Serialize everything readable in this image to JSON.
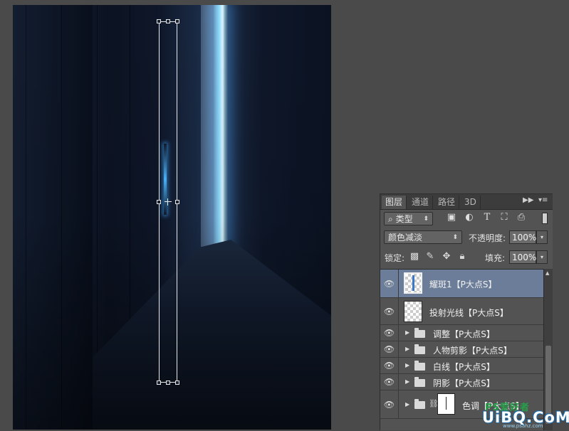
{
  "layers_panel": {
    "tabs": [
      {
        "label": "图层",
        "active": true
      },
      {
        "label": "通道",
        "active": false
      },
      {
        "label": "路径",
        "active": false
      },
      {
        "label": "3D",
        "active": false
      }
    ],
    "filter": {
      "kind_label": "类型"
    },
    "blend": {
      "mode": "颜色减淡",
      "opacity_label": "不透明度:",
      "opacity_value": "100%"
    },
    "lock": {
      "label": "锁定:",
      "fill_label": "填充:",
      "fill_value": "100%"
    },
    "layers": [
      {
        "name": "耀斑1【P大点S】",
        "type": "pixel",
        "selected": true,
        "visible": true
      },
      {
        "name": "投射光线【P大点S】",
        "type": "pixel",
        "selected": false,
        "visible": true
      },
      {
        "name": "调整【P大点S】",
        "type": "group",
        "selected": false,
        "visible": true
      },
      {
        "name": "人物剪影【P大点S】",
        "type": "group",
        "selected": false,
        "visible": true
      },
      {
        "name": "白线【P大点S】",
        "type": "group",
        "selected": false,
        "visible": true
      },
      {
        "name": "阴影【P大点S】",
        "type": "group",
        "selected": false,
        "visible": true
      },
      {
        "name": "色调【P大点S】",
        "type": "group-masked",
        "selected": false,
        "visible": true
      }
    ]
  },
  "watermark": {
    "ps": "PS爱好者",
    "main": "UiBQ.CoM",
    "url": "www.psahz.com"
  },
  "colors": {
    "panel_bg": "#535353",
    "selected_layer": "#6b7d98",
    "light_beam": "#8fdcff",
    "canvas_dark": "#0e1628"
  }
}
